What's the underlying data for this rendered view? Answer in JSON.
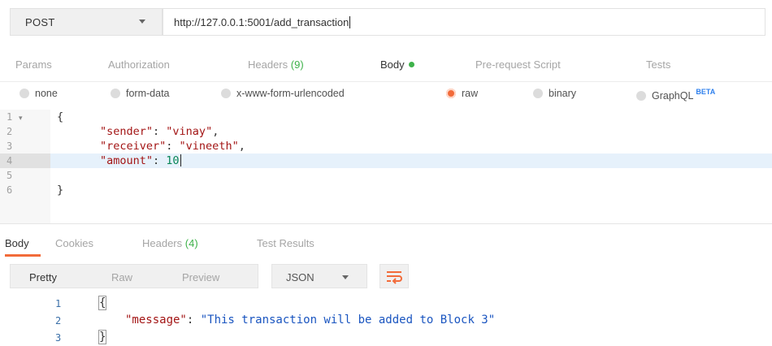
{
  "request": {
    "method": "POST",
    "url": "http://127.0.0.1:5001/add_transaction"
  },
  "request_tabs": [
    {
      "label": "Params"
    },
    {
      "label": "Authorization"
    },
    {
      "label": "Headers",
      "count": "(9)"
    },
    {
      "label": "Body"
    },
    {
      "label": "Pre-request Script"
    },
    {
      "label": "Tests"
    }
  ],
  "body_types": [
    {
      "label": "none",
      "selected": false
    },
    {
      "label": "form-data",
      "selected": false
    },
    {
      "label": "x-www-form-urlencoded",
      "selected": false
    },
    {
      "label": "raw",
      "selected": true
    },
    {
      "label": "binary",
      "selected": false
    },
    {
      "label": "GraphQL",
      "badge": "BETA",
      "selected": false
    }
  ],
  "editor": {
    "line_numbers": [
      "1",
      "2",
      "3",
      "4",
      "5",
      "6"
    ],
    "lines": {
      "l1": "{",
      "l2_key": "\"sender\"",
      "l2_val": "\"vinay\"",
      "l3_key": "\"receiver\"",
      "l3_val": "\"vineeth\"",
      "l4_key": "\"amount\"",
      "l4_val": "10",
      "l6": "}"
    }
  },
  "response_tabs": [
    {
      "label": "Body"
    },
    {
      "label": "Cookies"
    },
    {
      "label": "Headers",
      "count": "(4)"
    },
    {
      "label": "Test Results"
    }
  ],
  "response_toolbar": {
    "views": [
      "Pretty",
      "Raw",
      "Preview"
    ],
    "format": "JSON"
  },
  "response": {
    "line_numbers": [
      "1",
      "2",
      "3"
    ],
    "open": "{",
    "key": "\"message\"",
    "value": "\"This transaction will be added to Block 3\"",
    "close": "}"
  },
  "colors": {
    "accent": "#f26b3a",
    "count_green": "#3eb24a",
    "beta_blue": "#2f80ed"
  }
}
